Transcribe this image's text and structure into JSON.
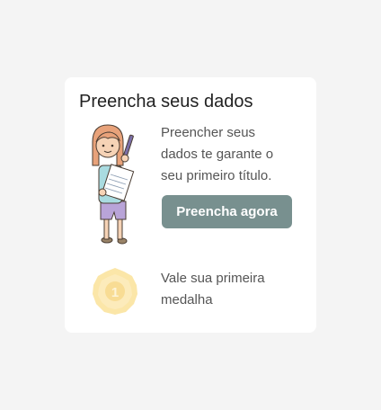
{
  "card": {
    "title": "Preencha seus dados",
    "cta_text": "Preencher seus dados te garante o seu primeiro título.",
    "cta_button_label": "Preencha agora",
    "medal_number": "1",
    "medal_text": "Vale sua primeira medalha"
  },
  "icons": {
    "illustration": "girl-writing-on-paper-illustration",
    "medal": "medal-icon"
  },
  "colors": {
    "page_background": "#f4f4f4",
    "card_background": "#ffffff",
    "button_background": "#78908f",
    "medal_fill": "#fbe6a8"
  }
}
